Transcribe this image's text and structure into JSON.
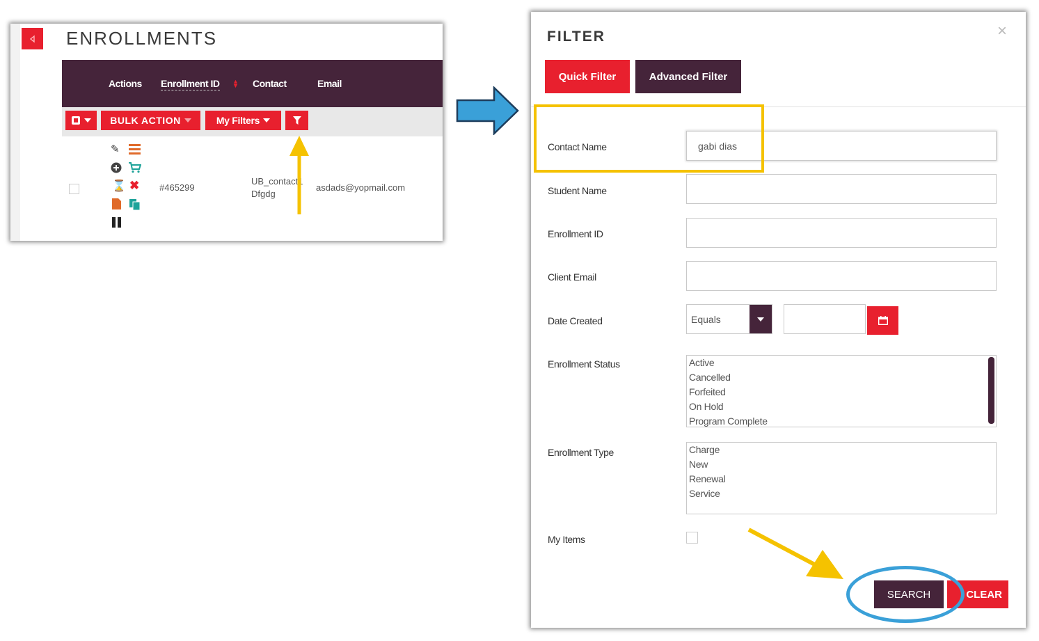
{
  "enrollments": {
    "title": "ENROLLMENTS",
    "columns": [
      "Actions",
      "Enrollment ID",
      "Contact",
      "Email"
    ],
    "toolbar": {
      "bulk_action": "BULK ACTION",
      "my_filters": "My Filters"
    },
    "row": {
      "id": "#465299",
      "contact_line1": "UB_contact1",
      "contact_line2": "Dfgdg",
      "email": "asdads@yopmail.com"
    }
  },
  "filter": {
    "title": "FILTER",
    "close": "×",
    "tabs": {
      "quick": "Quick Filter",
      "advanced": "Advanced Filter"
    },
    "fields": {
      "contact_name": {
        "label": "Contact Name",
        "value": "gabi dias"
      },
      "student_name": {
        "label": "Student Name",
        "value": ""
      },
      "enrollment_id": {
        "label": "Enrollment ID",
        "value": ""
      },
      "client_email": {
        "label": "Client Email",
        "value": ""
      },
      "date_created": {
        "label": "Date Created",
        "operator": "Equals",
        "value": ""
      },
      "enrollment_status": {
        "label": "Enrollment Status",
        "options": [
          "Active",
          "Cancelled",
          "Forfeited",
          "On Hold",
          "Program Complete"
        ]
      },
      "enrollment_type": {
        "label": "Enrollment Type",
        "options": [
          "Charge",
          "New",
          "Renewal",
          "Service"
        ]
      },
      "my_items": {
        "label": "My Items",
        "checked": false
      }
    },
    "buttons": {
      "search": "SEARCH",
      "clear": "CLEAR"
    }
  },
  "colors": {
    "accent_red": "#e8202e",
    "header_plum": "#45243a",
    "highlight_yellow": "#f5c200",
    "annotation_blue": "#3aa0d8"
  }
}
